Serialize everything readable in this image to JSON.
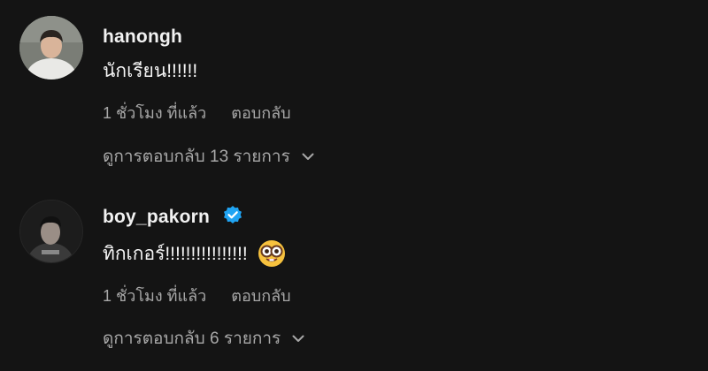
{
  "comments": [
    {
      "username": "hanongh",
      "verified": false,
      "text": "นักเรียน!!!!!!",
      "time": "1 ชั่วโมง ที่แล้ว",
      "reply_label": "ตอบกลับ",
      "view_replies": "ดูการตอบกลับ 13 รายการ"
    },
    {
      "username": "boy_pakorn",
      "verified": true,
      "text": "ทิกเกอร์!!!!!!!!!!!!!!!!",
      "emoji": "nerd-face-emoji",
      "time": "1 ชั่วโมง ที่แล้ว",
      "reply_label": "ตอบกลับ",
      "view_replies": "ดูการตอบกลับ 6 รายการ"
    }
  ],
  "colors": {
    "background": "#141414",
    "primary_text": "#f5f5f5",
    "secondary_text": "#a8a8a8",
    "verified_badge": "#1da1f2"
  }
}
